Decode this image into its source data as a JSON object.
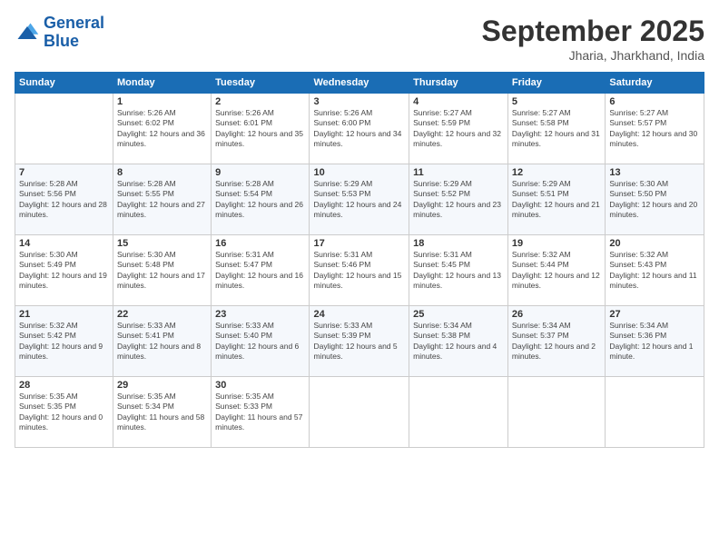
{
  "logo": {
    "line1": "General",
    "line2": "Blue"
  },
  "title": "September 2025",
  "location": "Jharia, Jharkhand, India",
  "days_of_week": [
    "Sunday",
    "Monday",
    "Tuesday",
    "Wednesday",
    "Thursday",
    "Friday",
    "Saturday"
  ],
  "weeks": [
    [
      {
        "day": "",
        "sunrise": "",
        "sunset": "",
        "daylight": ""
      },
      {
        "day": "1",
        "sunrise": "5:26 AM",
        "sunset": "6:02 PM",
        "daylight": "12 hours and 36 minutes."
      },
      {
        "day": "2",
        "sunrise": "5:26 AM",
        "sunset": "6:01 PM",
        "daylight": "12 hours and 35 minutes."
      },
      {
        "day": "3",
        "sunrise": "5:26 AM",
        "sunset": "6:00 PM",
        "daylight": "12 hours and 34 minutes."
      },
      {
        "day": "4",
        "sunrise": "5:27 AM",
        "sunset": "5:59 PM",
        "daylight": "12 hours and 32 minutes."
      },
      {
        "day": "5",
        "sunrise": "5:27 AM",
        "sunset": "5:58 PM",
        "daylight": "12 hours and 31 minutes."
      },
      {
        "day": "6",
        "sunrise": "5:27 AM",
        "sunset": "5:57 PM",
        "daylight": "12 hours and 30 minutes."
      }
    ],
    [
      {
        "day": "7",
        "sunrise": "5:28 AM",
        "sunset": "5:56 PM",
        "daylight": "12 hours and 28 minutes."
      },
      {
        "day": "8",
        "sunrise": "5:28 AM",
        "sunset": "5:55 PM",
        "daylight": "12 hours and 27 minutes."
      },
      {
        "day": "9",
        "sunrise": "5:28 AM",
        "sunset": "5:54 PM",
        "daylight": "12 hours and 26 minutes."
      },
      {
        "day": "10",
        "sunrise": "5:29 AM",
        "sunset": "5:53 PM",
        "daylight": "12 hours and 24 minutes."
      },
      {
        "day": "11",
        "sunrise": "5:29 AM",
        "sunset": "5:52 PM",
        "daylight": "12 hours and 23 minutes."
      },
      {
        "day": "12",
        "sunrise": "5:29 AM",
        "sunset": "5:51 PM",
        "daylight": "12 hours and 21 minutes."
      },
      {
        "day": "13",
        "sunrise": "5:30 AM",
        "sunset": "5:50 PM",
        "daylight": "12 hours and 20 minutes."
      }
    ],
    [
      {
        "day": "14",
        "sunrise": "5:30 AM",
        "sunset": "5:49 PM",
        "daylight": "12 hours and 19 minutes."
      },
      {
        "day": "15",
        "sunrise": "5:30 AM",
        "sunset": "5:48 PM",
        "daylight": "12 hours and 17 minutes."
      },
      {
        "day": "16",
        "sunrise": "5:31 AM",
        "sunset": "5:47 PM",
        "daylight": "12 hours and 16 minutes."
      },
      {
        "day": "17",
        "sunrise": "5:31 AM",
        "sunset": "5:46 PM",
        "daylight": "12 hours and 15 minutes."
      },
      {
        "day": "18",
        "sunrise": "5:31 AM",
        "sunset": "5:45 PM",
        "daylight": "12 hours and 13 minutes."
      },
      {
        "day": "19",
        "sunrise": "5:32 AM",
        "sunset": "5:44 PM",
        "daylight": "12 hours and 12 minutes."
      },
      {
        "day": "20",
        "sunrise": "5:32 AM",
        "sunset": "5:43 PM",
        "daylight": "12 hours and 11 minutes."
      }
    ],
    [
      {
        "day": "21",
        "sunrise": "5:32 AM",
        "sunset": "5:42 PM",
        "daylight": "12 hours and 9 minutes."
      },
      {
        "day": "22",
        "sunrise": "5:33 AM",
        "sunset": "5:41 PM",
        "daylight": "12 hours and 8 minutes."
      },
      {
        "day": "23",
        "sunrise": "5:33 AM",
        "sunset": "5:40 PM",
        "daylight": "12 hours and 6 minutes."
      },
      {
        "day": "24",
        "sunrise": "5:33 AM",
        "sunset": "5:39 PM",
        "daylight": "12 hours and 5 minutes."
      },
      {
        "day": "25",
        "sunrise": "5:34 AM",
        "sunset": "5:38 PM",
        "daylight": "12 hours and 4 minutes."
      },
      {
        "day": "26",
        "sunrise": "5:34 AM",
        "sunset": "5:37 PM",
        "daylight": "12 hours and 2 minutes."
      },
      {
        "day": "27",
        "sunrise": "5:34 AM",
        "sunset": "5:36 PM",
        "daylight": "12 hours and 1 minute."
      }
    ],
    [
      {
        "day": "28",
        "sunrise": "5:35 AM",
        "sunset": "5:35 PM",
        "daylight": "12 hours and 0 minutes."
      },
      {
        "day": "29",
        "sunrise": "5:35 AM",
        "sunset": "5:34 PM",
        "daylight": "11 hours and 58 minutes."
      },
      {
        "day": "30",
        "sunrise": "5:35 AM",
        "sunset": "5:33 PM",
        "daylight": "11 hours and 57 minutes."
      },
      {
        "day": "",
        "sunrise": "",
        "sunset": "",
        "daylight": ""
      },
      {
        "day": "",
        "sunrise": "",
        "sunset": "",
        "daylight": ""
      },
      {
        "day": "",
        "sunrise": "",
        "sunset": "",
        "daylight": ""
      },
      {
        "day": "",
        "sunrise": "",
        "sunset": "",
        "daylight": ""
      }
    ]
  ]
}
